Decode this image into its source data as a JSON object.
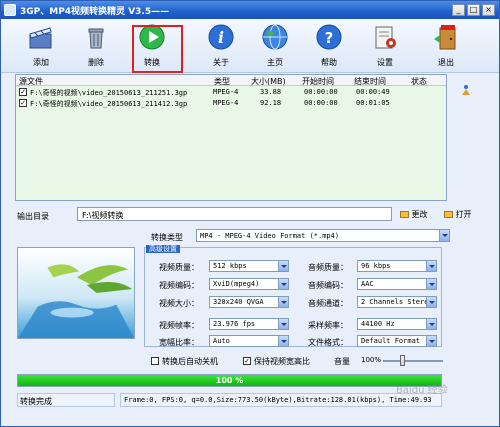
{
  "window": {
    "title": "3GP、MP4视频转换精灵 V3.5——",
    "min": "_",
    "max": "□",
    "close": "×"
  },
  "toolbar": {
    "add": "添加",
    "delete": "删除",
    "convert": "转换",
    "about": "关于",
    "home": "主页",
    "help": "帮助",
    "settings": "设置",
    "exit": "退出"
  },
  "file_list": {
    "columns": [
      "源文件",
      "类型",
      "大小(MB)",
      "开始时间",
      "结束时间",
      "状态"
    ],
    "rows": [
      {
        "file": "F:\\奇怪的视频\\video_20150613_211251.3gp",
        "type": "MPEG-4",
        "size": "33.88",
        "start": "00:00:00",
        "end": "00:00:49",
        "status": ""
      },
      {
        "file": "F:\\奇怪的视频\\video_20150613_211412.3gp",
        "type": "MPEG-4",
        "size": "92.18",
        "start": "00:00:00",
        "end": "00:01:05",
        "status": ""
      }
    ]
  },
  "output": {
    "label": "输出目录",
    "path": "F:\\视频转换",
    "change": "更改",
    "open": "打开"
  },
  "format": {
    "label": "转换类型",
    "value": "MP4 - MPEG-4 Video Format (*.mp4)"
  },
  "advanced": {
    "title": "高级设置",
    "video_quality_label": "视频质量：",
    "video_quality": "512 kbps",
    "video_codec_label": "视频编码：",
    "video_codec": "XviD(mpeg4)",
    "video_size_label": "视频大小：",
    "video_size": "320x240 QVGA",
    "video_fps_label": "视频帧率：",
    "video_fps": "23.976 fps",
    "aspect_label": "宽幅比率：",
    "aspect": "Auto",
    "audio_quality_label": "音频质量：",
    "audio_quality": "96  kbps",
    "audio_codec_label": "音频编码：",
    "audio_codec": "AAC",
    "audio_channel_label": "音频通道：",
    "audio_channel": "2 Channels Stere",
    "sample_rate_label": "采样频率：",
    "sample_rate": "44100 Hz",
    "file_format_label": "文件格式：",
    "file_format": "Default Format"
  },
  "options": {
    "auto_shutdown": "转换后自动关机",
    "keep_ratio": "保持视频宽高比",
    "volume_label": "音量",
    "volume_value": "100%",
    "volume_level": 0.3
  },
  "progress": {
    "value": 1.0,
    "text": "100 %"
  },
  "status": {
    "left": "转换完成",
    "right": "Frame:0, FPS:0, q=0.0,Size:773.50(kByte),Bitrate:128.01(kbps), Time:49.93"
  },
  "watermark": "Baidu 经验",
  "colors": {
    "titlebar": "#1f5fcc",
    "list_bg": "#e9f7e6",
    "progress": "#11b50f",
    "highlight": "#e02020"
  }
}
